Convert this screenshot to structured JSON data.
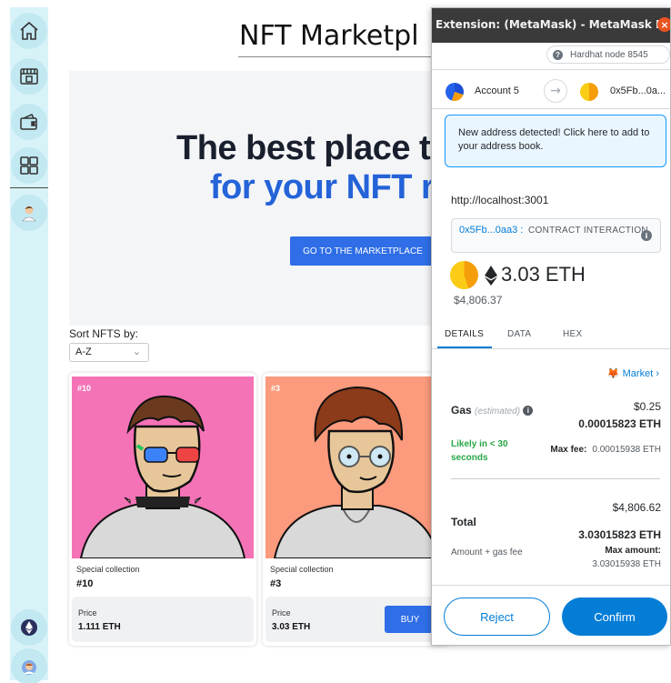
{
  "sidebar": {
    "items": [
      {
        "icon": "home-icon"
      },
      {
        "icon": "storefront-icon"
      },
      {
        "icon": "wallet-icon"
      },
      {
        "icon": "dashboard-icon"
      },
      {
        "icon": "profile-avatar"
      }
    ],
    "bottom": [
      {
        "icon": "ethereum-icon"
      },
      {
        "icon": "user-avatar"
      }
    ]
  },
  "marketplace": {
    "title": "NFT Marketpl",
    "hero": {
      "line1": "The best place t",
      "line2": "for your NFT r",
      "button_label": "GO TO THE MARKETPLACE"
    },
    "sort": {
      "label": "Sort NFTS by:",
      "selected": "A-Z"
    },
    "cards": [
      {
        "badge": "#10",
        "collection": "Special collection",
        "name": "#10",
        "price_label": "Price",
        "price": "1.111 ETH",
        "bg_color": "#f472b6"
      },
      {
        "badge": "#3",
        "collection": "Special collection",
        "name": "#3",
        "price_label": "Price",
        "price": "3.03 ETH",
        "buy_label": "BUY",
        "bg_color": "#fb9a7c"
      }
    ]
  },
  "metamask": {
    "window_title": "Extension: (MetaMask) - MetaMask N...",
    "network": "Hardhat node 8545",
    "from_account": "Account 5",
    "to_account": "0x5Fb...0a...",
    "notice": "New address detected! Click here to add to your address book.",
    "origin": "http://localhost:3001",
    "contract_address": "0x5Fb...0aa3 :",
    "contract_type": "CONTRACT INTERACTION",
    "amount": "3.03 ETH",
    "amount_fiat": "$4,806.37",
    "tabs": [
      {
        "label": "DETAILS",
        "active": true
      },
      {
        "label": "DATA",
        "active": false
      },
      {
        "label": "HEX",
        "active": false
      }
    ],
    "market_label": "Market",
    "gas": {
      "label": "Gas",
      "estimated": "(estimated)",
      "fiat": "$0.25",
      "eth": "0.00015823 ETH",
      "likely": "Likely in < 30 seconds",
      "max_fee_label": "Max fee:",
      "max_fee": "0.00015938 ETH"
    },
    "total": {
      "label": "Total",
      "fiat": "$4,806.62",
      "eth": "3.03015823 ETH",
      "amount_gas_label": "Amount + gas fee",
      "max_amount_label": "Max amount:",
      "max_amount": "3.03015938 ETH"
    },
    "reject_label": "Reject",
    "confirm_label": "Confirm"
  },
  "colors": {
    "accent_blue": "#2f6ee6",
    "metamask_blue": "#037dd6",
    "success_green": "#28a745",
    "sidebar_bg": "#d8f3f8"
  }
}
